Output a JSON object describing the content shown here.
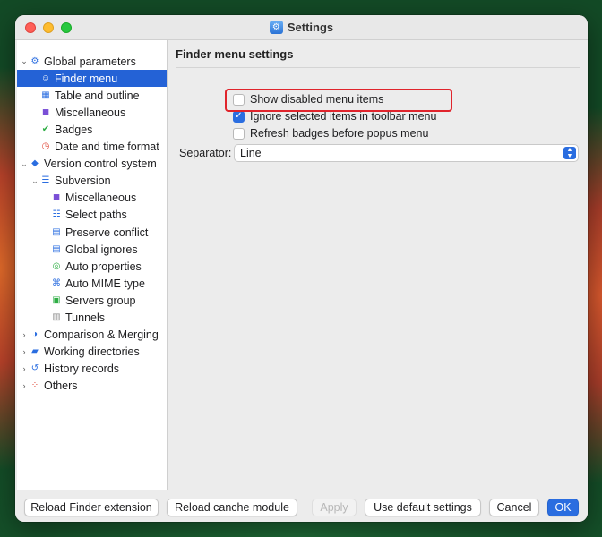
{
  "window": {
    "title": "Settings"
  },
  "sidebar": {
    "items": [
      {
        "label": "Global parameters",
        "chevron": "down",
        "icon": "gear-icon",
        "color": "#2a6de0"
      },
      {
        "label": "Finder menu",
        "icon": "finder-icon",
        "color": "#e45a7a",
        "selected": true
      },
      {
        "label": "Table and outline",
        "icon": "table-icon",
        "color": "#2a6de0"
      },
      {
        "label": "Miscellaneous",
        "icon": "grid-icon",
        "color": "#7a4fd6"
      },
      {
        "label": "Badges",
        "icon": "check-badge-icon",
        "color": "#2fae45"
      },
      {
        "label": "Date and time format",
        "icon": "clock-icon",
        "color": "#e04a3a"
      },
      {
        "label": "Version control system",
        "chevron": "down",
        "icon": "layers-icon",
        "color": "#2a6de0"
      },
      {
        "label": "Subversion",
        "chevron": "down",
        "icon": "list-icon",
        "color": "#2a6de0"
      },
      {
        "label": "Miscellaneous",
        "icon": "grid-icon",
        "color": "#7a4fd6"
      },
      {
        "label": "Select paths",
        "icon": "list-check-icon",
        "color": "#2a6de0"
      },
      {
        "label": "Preserve conflict",
        "icon": "doc-icon",
        "color": "#2a6de0"
      },
      {
        "label": "Global ignores",
        "icon": "doc-icon",
        "color": "#2a6de0"
      },
      {
        "label": "Auto properties",
        "icon": "circle-icon",
        "color": "#2fae45"
      },
      {
        "label": "Auto MIME type",
        "icon": "code-icon",
        "color": "#2a6de0"
      },
      {
        "label": "Servers group",
        "icon": "server-icon",
        "color": "#2fae45"
      },
      {
        "label": "Tunnels",
        "icon": "tunnel-icon",
        "color": "#888888"
      },
      {
        "label": "Comparison & Merging",
        "chevron": "right",
        "icon": "compare-icon",
        "color": "#2a6de0"
      },
      {
        "label": "Working directories",
        "chevron": "right",
        "icon": "folder-icon",
        "color": "#2a6de0"
      },
      {
        "label": "History records",
        "chevron": "right",
        "icon": "history-icon",
        "color": "#2a6de0"
      },
      {
        "label": "Others",
        "chevron": "right",
        "icon": "dots-icon",
        "color": "#e04a3a"
      }
    ]
  },
  "main": {
    "title": "Finder menu settings",
    "options": [
      {
        "label": "Show disabled menu items",
        "checked": false
      },
      {
        "label": "Ignore selected items in toolbar menu",
        "checked": true
      },
      {
        "label": "Refresh badges before popus menu",
        "checked": false
      }
    ],
    "separator": {
      "label": "Separator:",
      "value": "Line"
    }
  },
  "footer": {
    "reload_finder": "Reload Finder extension",
    "reload_cache": "Reload canche module",
    "apply": "Apply",
    "use_default": "Use default settings",
    "cancel": "Cancel",
    "ok": "OK"
  },
  "colors": {
    "accent": "#2a6de0",
    "highlight": "#e0242c",
    "selection": "#2462d6"
  }
}
